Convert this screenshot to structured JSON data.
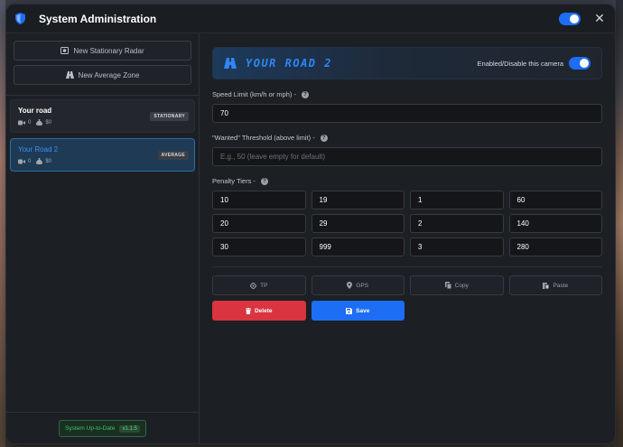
{
  "window": {
    "title": "System Administration",
    "master_enabled": true
  },
  "sidebar": {
    "new_stationary_label": "New Stationary Radar",
    "new_average_label": "New Average Zone",
    "cameras": [
      {
        "name": "Your road",
        "count": "0",
        "amount": "$0",
        "type": "STATIONARY",
        "active": false
      },
      {
        "name": "Your Road 2",
        "count": "0",
        "amount": "$0",
        "type": "AVERAGE",
        "active": true
      }
    ],
    "status_text": "System Up-to-Date",
    "version": "v1.1.5"
  },
  "main": {
    "camera_title": "YOUR ROAD 2",
    "enable_label": "Enabled/Disable this camera",
    "enabled": true,
    "speed_label": "Speed Limit (km/h or mph) -",
    "speed_value": "70",
    "threshold_label": "\"Wanted\" Threshold (above limit) -",
    "threshold_placeholder": "E.g., 50 (leave empty for default)",
    "threshold_value": "",
    "tiers_label": "Penalty Tiers -",
    "help_glyph": "?",
    "tiers": [
      [
        "10",
        "19",
        "1",
        "60"
      ],
      [
        "20",
        "29",
        "2",
        "140"
      ],
      [
        "30",
        "999",
        "3",
        "280"
      ]
    ],
    "tp_label": "TP",
    "gps_label": "GPS",
    "copy_label": "Copy",
    "paste_label": "Paste",
    "delete_label": "Delete",
    "save_label": "Save"
  },
  "colors": {
    "accent": "#1d6ef5",
    "danger": "#d9343f",
    "success": "#3ec46d"
  }
}
